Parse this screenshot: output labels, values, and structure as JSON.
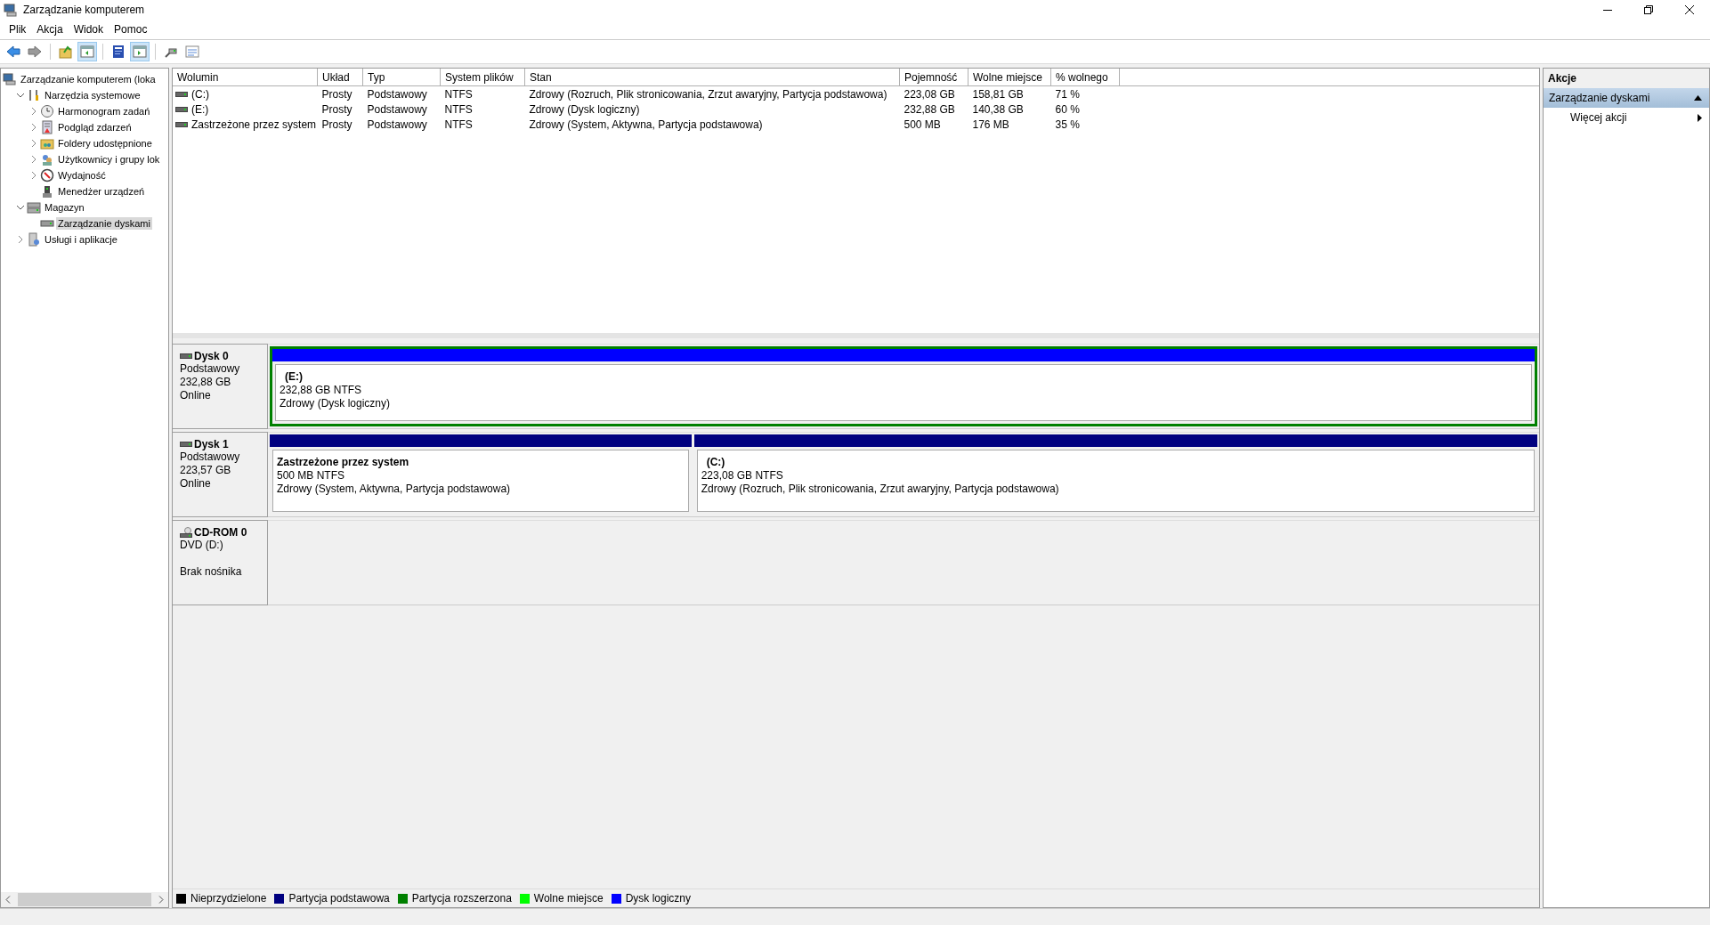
{
  "window": {
    "title": "Zarządzanie komputerem"
  },
  "menu": [
    "Plik",
    "Akcja",
    "Widok",
    "Pomoc"
  ],
  "toolbar": [
    {
      "pressed": false
    },
    {
      "pressed": false
    },
    {
      "pressed": false
    },
    {
      "pressed": true
    },
    {
      "pressed": false
    },
    {
      "pressed": true
    },
    {
      "pressed": false
    },
    {
      "pressed": false
    }
  ],
  "tree": [
    {
      "label": "Zarządzanie komputerem (loka",
      "selected": false,
      "children": [
        {
          "label": "Narzędzia systemowe",
          "selected": false,
          "expanded": true,
          "children": [
            {
              "label": "Harmonogram zadań",
              "selected": false,
              "expanded": false
            },
            {
              "label": "Podgląd zdarzeń",
              "selected": false,
              "expanded": false
            },
            {
              "label": "Foldery udostępnione",
              "selected": false,
              "expanded": false
            },
            {
              "label": "Użytkownicy i grupy lok",
              "selected": false,
              "expanded": false
            },
            {
              "label": "Wydajność",
              "selected": false,
              "expanded": false
            },
            {
              "label": "Menedżer urządzeń",
              "selected": false
            }
          ]
        },
        {
          "label": "Magazyn",
          "selected": false,
          "expanded": true,
          "children": [
            {
              "label": "Zarządzanie dyskami",
              "selected": true
            }
          ]
        },
        {
          "label": "Usługi i aplikacje",
          "selected": false,
          "expanded": false
        }
      ]
    }
  ],
  "volumes": {
    "columns": [
      "Wolumin",
      "Układ",
      "Typ",
      "System plików",
      "Stan",
      "Pojemność",
      "Wolne miejsce",
      "% wolnego"
    ],
    "rows": [
      [
        "(C:)",
        "Prosty",
        "Podstawowy",
        "NTFS",
        "Zdrowy (Rozruch, Plik stronicowania, Zrzut awaryjny, Partycja podstawowa)",
        "223,08 GB",
        "158,81 GB",
        "71 %"
      ],
      [
        "(E:)",
        "Prosty",
        "Podstawowy",
        "NTFS",
        "Zdrowy (Dysk logiczny)",
        "232,88 GB",
        "140,38 GB",
        "60 %"
      ],
      [
        "Zastrzeżone przez system",
        "Prosty",
        "Podstawowy",
        "NTFS",
        "Zdrowy (System, Aktywna, Partycja podstawowa)",
        "500 MB",
        "176 MB",
        "35 %"
      ]
    ]
  },
  "disks": [
    {
      "kind": "disk",
      "name": "Dysk 0",
      "lines": [
        "Podstawowy",
        "232,88 GB",
        "Online"
      ],
      "partitions": [
        {
          "kind": "logical",
          "title": "(E:)",
          "size": "232,88 GB NTFS",
          "status": "Zdrowy (Dysk logiczny)"
        }
      ]
    },
    {
      "kind": "disk",
      "name": "Dysk 1",
      "lines": [
        "Podstawowy",
        "223,57 GB",
        "Online"
      ],
      "partitions": [
        {
          "kind": "primary",
          "title": "Zastrzeżone przez system",
          "size": "500 MB NTFS",
          "status": "Zdrowy (System, Aktywna, Partycja podstawowa)"
        },
        {
          "kind": "primary",
          "title": "(C:)",
          "size": "223,08 GB NTFS",
          "status": "Zdrowy (Rozruch, Plik stronicowania, Zrzut awaryjny, Partycja podstawowa)"
        }
      ]
    },
    {
      "kind": "cdrom",
      "name": "CD-ROM 0",
      "lines": [
        "DVD (D:)",
        "Brak nośnika"
      ]
    }
  ],
  "legend": [
    {
      "label": "Nieprzydzielone",
      "color": "#000000"
    },
    {
      "label": "Partycja podstawowa",
      "color": "#000080"
    },
    {
      "label": "Partycja rozszerzona",
      "color": "#008000"
    },
    {
      "label": "Wolne miejsce",
      "color": "#00ff00"
    },
    {
      "label": "Dysk logiczny",
      "color": "#0000ff"
    }
  ],
  "actions": {
    "header": "Akcje",
    "sections": [
      {
        "title": "Zarządzanie dyskami",
        "expanded": true,
        "items": [
          "Więcej akcji"
        ]
      }
    ]
  }
}
